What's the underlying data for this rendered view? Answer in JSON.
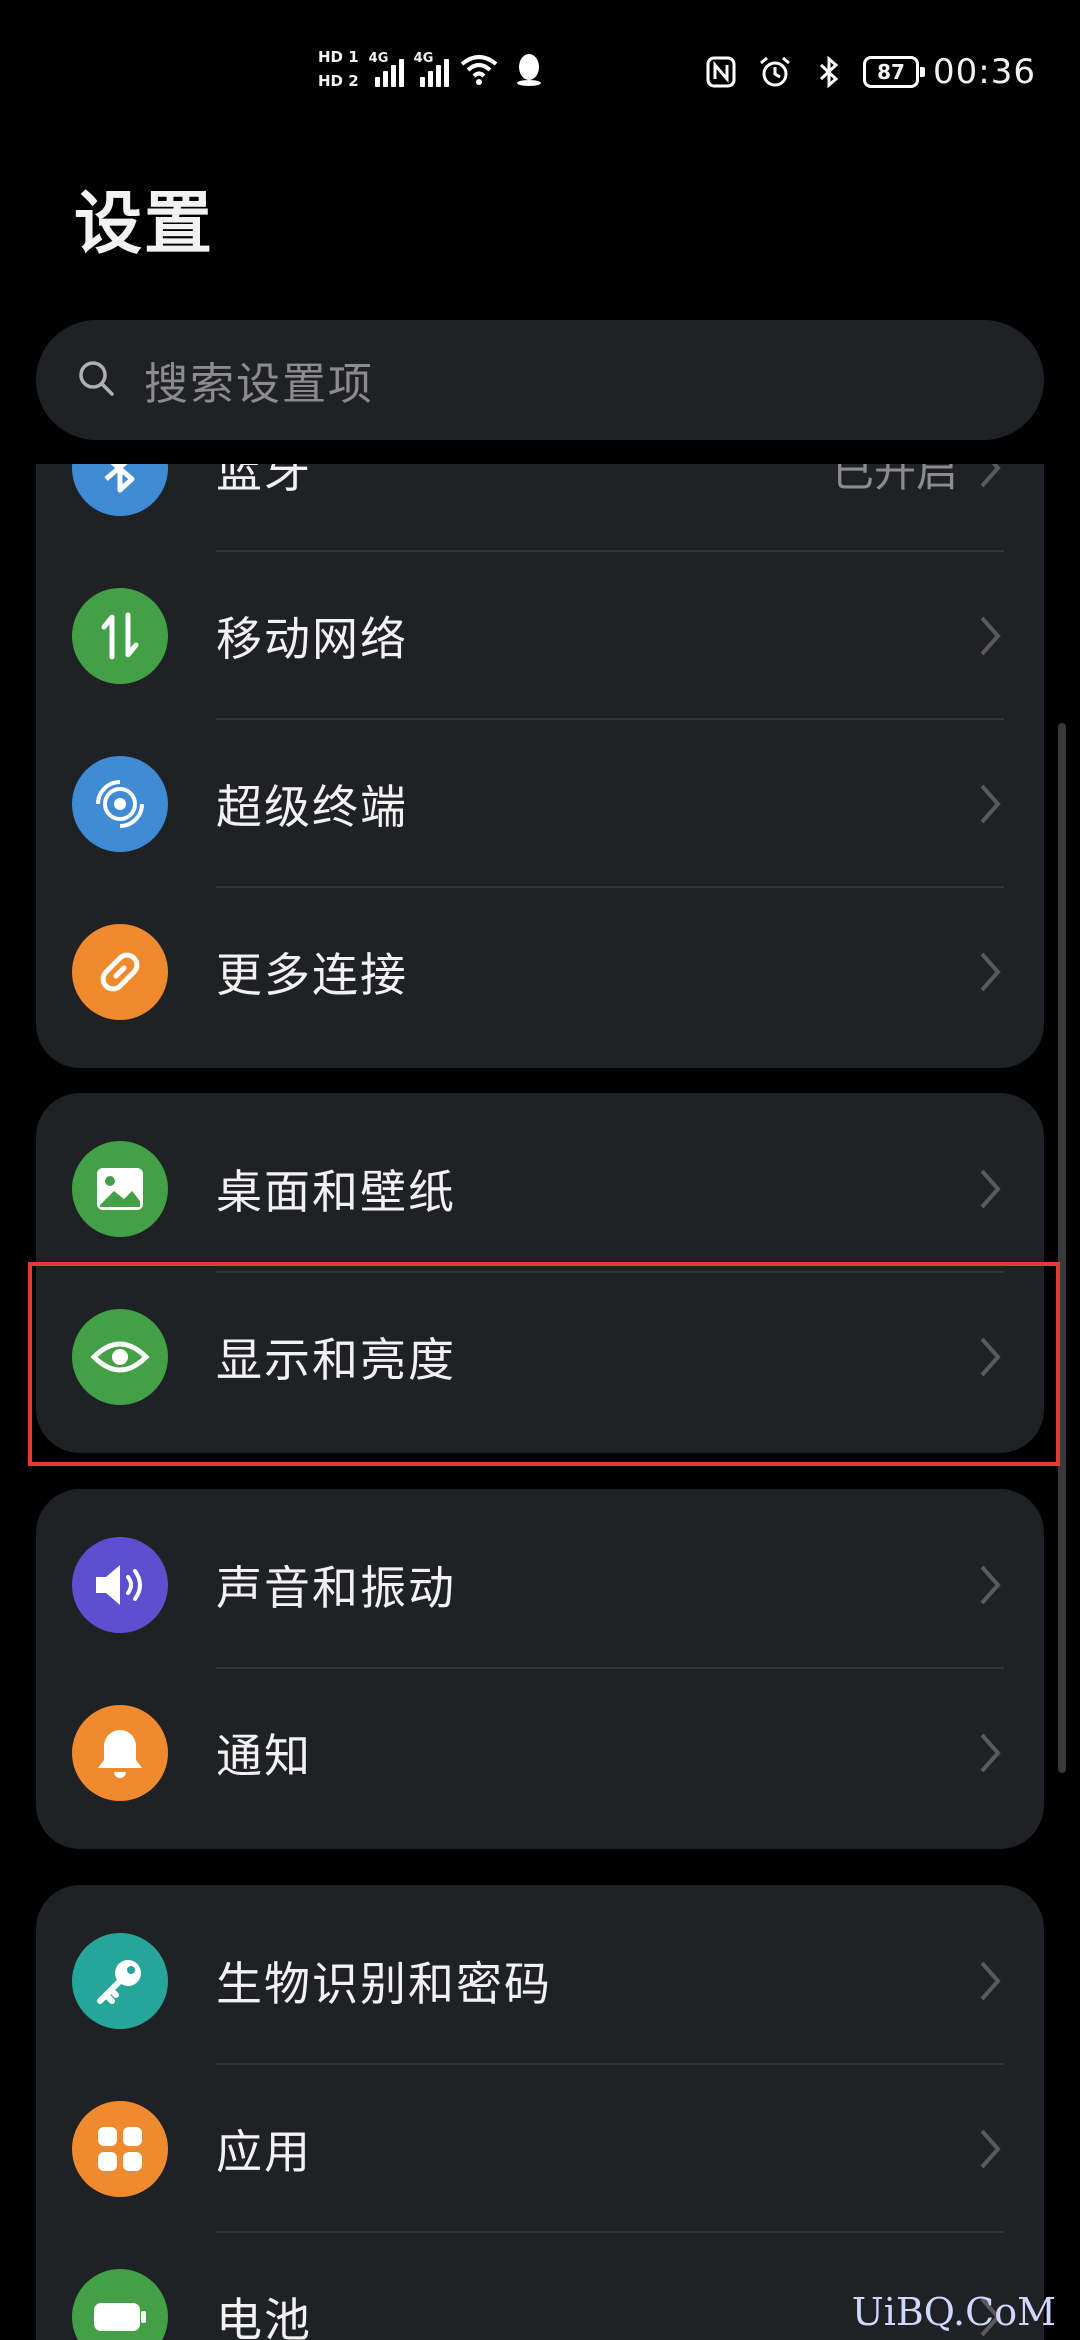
{
  "status_bar": {
    "sim1": "HD 1",
    "sim2": "HD 2",
    "net1": "4G",
    "net2": "4G",
    "battery": "87",
    "time": "00:36"
  },
  "title": "设置",
  "search": {
    "placeholder": "搜索设置项"
  },
  "groups": [
    {
      "items": [
        {
          "label": "蓝牙",
          "value": "已开启",
          "icon": "bluetooth-icon",
          "color": "#3f8bd4"
        },
        {
          "label": "移动网络",
          "icon": "mobile-data-icon",
          "color": "#43a047"
        },
        {
          "label": "超级终端",
          "icon": "super-device-icon",
          "color": "#3f8bd4"
        },
        {
          "label": "更多连接",
          "icon": "link-icon",
          "color": "#ef8a2e"
        }
      ]
    },
    {
      "items": [
        {
          "label": "桌面和壁纸",
          "icon": "wallpaper-icon",
          "color": "#43a047"
        },
        {
          "label": "显示和亮度",
          "icon": "eye-icon",
          "color": "#43a047"
        }
      ]
    },
    {
      "items": [
        {
          "label": "声音和振动",
          "icon": "speaker-icon",
          "color": "#5e4fd1"
        },
        {
          "label": "通知",
          "icon": "bell-icon",
          "color": "#ef8a2e"
        }
      ]
    },
    {
      "items": [
        {
          "label": "生物识别和密码",
          "icon": "key-icon",
          "color": "#26a69a"
        },
        {
          "label": "应用",
          "icon": "apps-icon",
          "color": "#ef8a2e"
        },
        {
          "label": "电池",
          "icon": "battery-icon",
          "color": "#43a047"
        }
      ]
    }
  ],
  "highlight_color": "#e53935",
  "watermark": "UiBQ.CoM"
}
